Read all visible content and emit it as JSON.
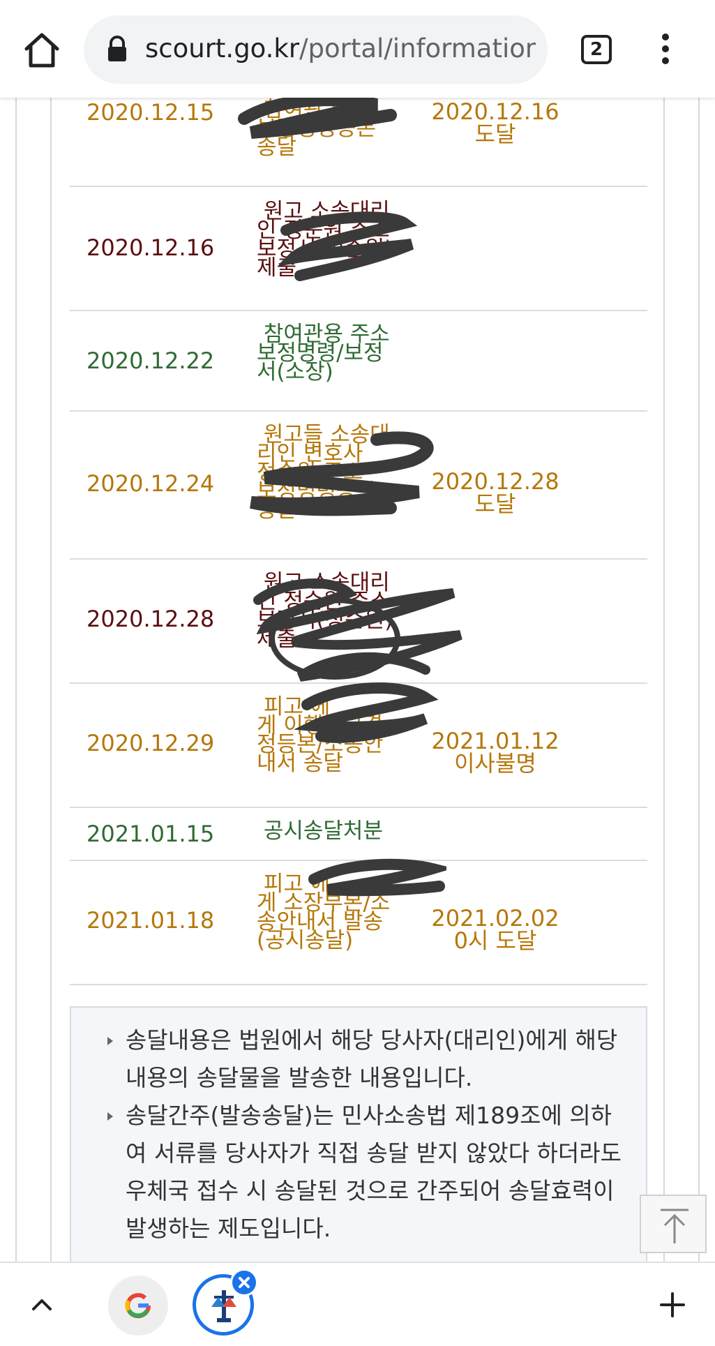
{
  "browser": {
    "url_domain": "scourt.go.kr",
    "url_path": "/portal/information",
    "tab_count": "2"
  },
  "delivery_rows": [
    {
      "date": "2020.12.15",
      "content": " 참여관 주소\n보정명령등본\n송달",
      "result": "2020.12.16\n도달",
      "color": "#b5770a"
    },
    {
      "date": "2020.12.16",
      "content": " 원고 소송대리\n인 정순원 주소\n보정서(정순원)\n제출",
      "result": "",
      "color": "#5a0f0f"
    },
    {
      "date": "2020.12.22",
      "content": " 참여관용 주소\n보정명령/보정\n서(소장)",
      "result": "",
      "color": "#2f6a33"
    },
    {
      "date": "2020.12.24",
      "content": " 원고들 소송대\n리인 변호사 \n정순원 주소\n보정명령등본\n송달",
      "result": "2020.12.28\n도달",
      "color": "#b5770a"
    },
    {
      "date": "2020.12.28",
      "content": " 원고 소송대리\n인 정순원 주소\n보정서(정순원)\n제출",
      "result": "",
      "color": "#5a0f0f"
    },
    {
      "date": "2020.12.29",
      "content": " 피고 에\n게 이행권고결\n정등본/소송안\n내서 송달",
      "result": "2021.01.12\n이사불명",
      "color": "#b5770a"
    },
    {
      "date": "2021.01.15",
      "content": " 공시송달처분",
      "result": "",
      "color": "#2f6a33"
    },
    {
      "date": "2021.01.18",
      "content": " 피고 에\n게 소장부본/소\n송안내서 발송\n(공시송달)",
      "result": "2021.02.02\n0시 도달",
      "color": "#b5770a"
    }
  ],
  "notices": [
    "송달내용은 법원에서 해당 당사자(대리인)에게 해당 내용의 송달물을 발송한 내용입니다.",
    "송달간주(발송송달)는 민사소송법 제189조에 의하여 서류를 당사자가 직접 송달 받지 않았다 하더라도 우체국 접수 시 송달된 것으로 간주되어 송달효력이 발생하는 제도입니다."
  ],
  "icons": {
    "home": "home-icon",
    "lock": "lock-icon",
    "menu": "more-vert-icon",
    "to_top": "arrow-up-icon",
    "chevron": "chevron-up-icon",
    "google": "google-icon",
    "court": "court-icon",
    "close": "close-icon",
    "plus": "plus-icon"
  },
  "colors": {
    "orange_text": "#b5770a",
    "maroon_text": "#5a0f0f",
    "green_text": "#2f6a33",
    "accent_blue": "#1a73e8"
  }
}
